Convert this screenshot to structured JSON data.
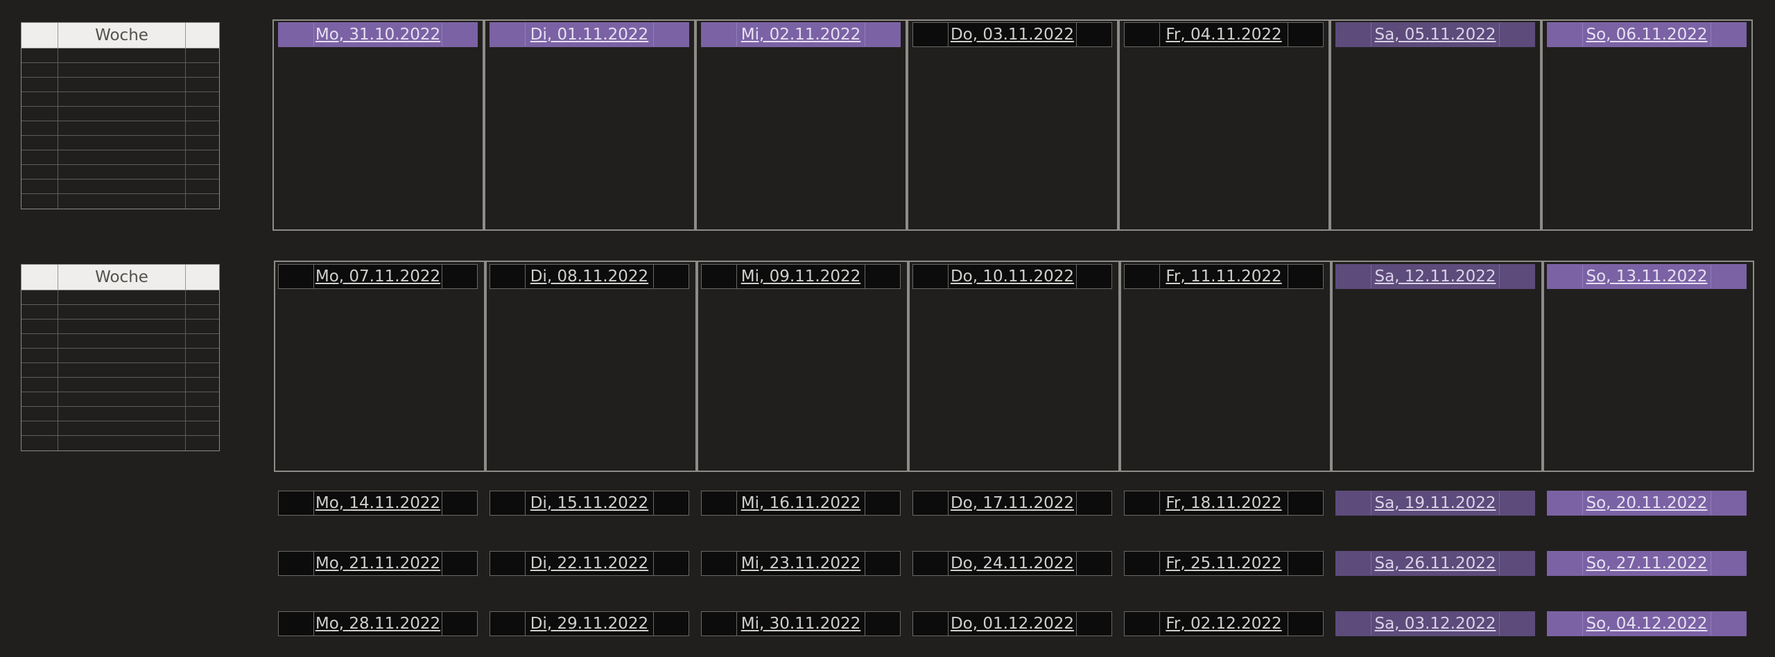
{
  "week_tables": [
    {
      "header": "Woche"
    },
    {
      "header": "Woche"
    }
  ],
  "weeks": [
    {
      "days": [
        {
          "label": "Mo, 31.10.2022",
          "style": "hl"
        },
        {
          "label": "Di, 01.11.2022",
          "style": "hl"
        },
        {
          "label": "Mi, 02.11.2022",
          "style": "hl"
        },
        {
          "label": "Do, 03.11.2022",
          "style": "weekday"
        },
        {
          "label": "Fr, 04.11.2022",
          "style": "weekday"
        },
        {
          "label": "Sa, 05.11.2022",
          "style": "sat"
        },
        {
          "label": "So, 06.11.2022",
          "style": "hl"
        }
      ]
    },
    {
      "days": [
        {
          "label": "Mo, 07.11.2022",
          "style": "weekday"
        },
        {
          "label": "Di, 08.11.2022",
          "style": "weekday"
        },
        {
          "label": "Mi, 09.11.2022",
          "style": "weekday"
        },
        {
          "label": "Do, 10.11.2022",
          "style": "weekday"
        },
        {
          "label": "Fr, 11.11.2022",
          "style": "weekday"
        },
        {
          "label": "Sa, 12.11.2022",
          "style": "sat"
        },
        {
          "label": "So, 13.11.2022",
          "style": "hl"
        }
      ]
    },
    {
      "days": [
        {
          "label": "Mo, 14.11.2022",
          "style": "weekday"
        },
        {
          "label": "Di, 15.11.2022",
          "style": "weekday"
        },
        {
          "label": "Mi, 16.11.2022",
          "style": "weekday"
        },
        {
          "label": "Do, 17.11.2022",
          "style": "weekday"
        },
        {
          "label": "Fr, 18.11.2022",
          "style": "weekday"
        },
        {
          "label": "Sa, 19.11.2022",
          "style": "sat"
        },
        {
          "label": "So, 20.11.2022",
          "style": "hl"
        }
      ]
    },
    {
      "days": [
        {
          "label": "Mo, 21.11.2022",
          "style": "weekday"
        },
        {
          "label": "Di, 22.11.2022",
          "style": "weekday"
        },
        {
          "label": "Mi, 23.11.2022",
          "style": "weekday"
        },
        {
          "label": "Do, 24.11.2022",
          "style": "weekday"
        },
        {
          "label": "Fr, 25.11.2022",
          "style": "weekday"
        },
        {
          "label": "Sa, 26.11.2022",
          "style": "sat"
        },
        {
          "label": "So, 27.11.2022",
          "style": "hl"
        }
      ]
    },
    {
      "days": [
        {
          "label": "Mo, 28.11.2022",
          "style": "weekday"
        },
        {
          "label": "Di, 29.11.2022",
          "style": "weekday"
        },
        {
          "label": "Mi, 30.11.2022",
          "style": "weekday"
        },
        {
          "label": "Do, 01.12.2022",
          "style": "weekday"
        },
        {
          "label": "Fr, 02.12.2022",
          "style": "weekday"
        },
        {
          "label": "Sa, 03.12.2022",
          "style": "sat"
        },
        {
          "label": "So, 04.12.2022",
          "style": "hl"
        }
      ]
    }
  ],
  "colors": {
    "background": "#201f1d",
    "highlight_purple": "#7b62a4",
    "saturday_purple": "#5d4b7b",
    "weekday_bar": "#0c0c0c"
  }
}
